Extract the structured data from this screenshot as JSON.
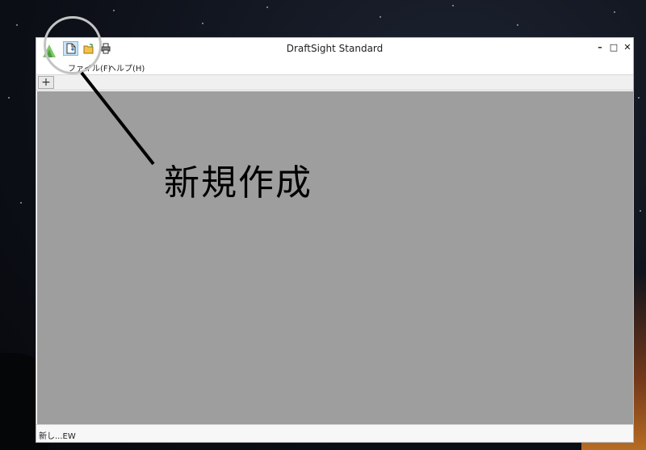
{
  "window": {
    "title": "DraftSight Standard",
    "controls": {
      "minimize": "–",
      "maximize": "□",
      "close": "✕"
    }
  },
  "quick_access": [
    {
      "name": "new-document-icon"
    },
    {
      "name": "open-folder-icon"
    },
    {
      "name": "print-icon"
    }
  ],
  "menu": {
    "file": "ファイル(F)",
    "help": "ヘルプ(H)"
  },
  "tabs": {
    "add_label": "+"
  },
  "status": {
    "text": "新し...EW"
  },
  "annotation": {
    "label": "新規作成"
  },
  "colors": {
    "workspace": "#9e9e9e",
    "highlight": "#cce4f7",
    "callout_circle": "#c4c4c4"
  }
}
